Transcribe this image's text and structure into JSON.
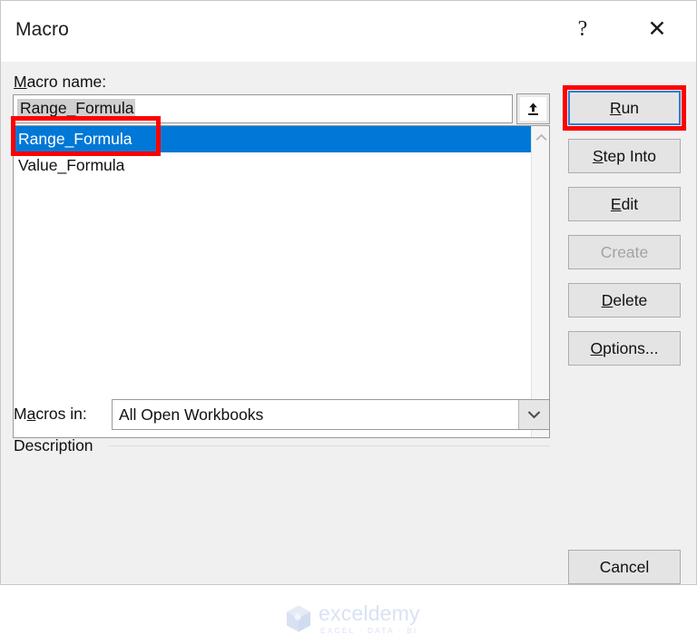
{
  "window": {
    "title": "Macro",
    "help_icon": "question-mark-icon",
    "close_icon": "close-icon"
  },
  "form": {
    "macro_name_label_pre": "M",
    "macro_name_label_post": "acro name:",
    "macro_name_value": "Range_Formula",
    "upload_icon": "arrow-up-upload-icon"
  },
  "macro_list": {
    "items": [
      {
        "name": "Range_Formula",
        "selected": true
      },
      {
        "name": "Value_Formula",
        "selected": false
      }
    ],
    "scroll_up_icon": "chevron-up-icon",
    "scroll_down_icon": "chevron-down-icon"
  },
  "macros_in": {
    "label_pre": "M",
    "label_mid": "a",
    "label_post": "cros in:",
    "selected_value": "All Open Workbooks",
    "dropdown_icon": "chevron-down-icon"
  },
  "description": {
    "label": "Description",
    "text": ""
  },
  "buttons": [
    {
      "name": "run",
      "pre": "R",
      "accel": "",
      "post": "un",
      "label": "Run",
      "disabled": false,
      "focused": true
    },
    {
      "name": "step-into",
      "pre": "",
      "accel": "S",
      "post": "tep Into",
      "label": "Step Into",
      "disabled": false,
      "focused": false
    },
    {
      "name": "edit",
      "pre": "",
      "accel": "E",
      "post": "dit",
      "label": "Edit",
      "disabled": false,
      "focused": false
    },
    {
      "name": "create",
      "pre": "",
      "accel": "",
      "post": "Create",
      "label": "Create",
      "disabled": true,
      "focused": false
    },
    {
      "name": "delete",
      "pre": "",
      "accel": "D",
      "post": "elete",
      "label": "Delete",
      "disabled": false,
      "focused": false
    },
    {
      "name": "options",
      "pre": "",
      "accel": "O",
      "post": "ptions...",
      "label": "Options...",
      "disabled": false,
      "focused": false
    },
    {
      "name": "cancel",
      "pre": "",
      "accel": "",
      "post": "Cancel",
      "label": "Cancel",
      "disabled": false,
      "focused": false
    }
  ],
  "button_labels": {
    "run_accel": "R",
    "run_rest": "un",
    "step_into_accel": "S",
    "step_into_rest": "tep Into",
    "edit_accel": "E",
    "edit_rest": "dit",
    "create": "Create",
    "delete_accel": "D",
    "delete_rest": "elete",
    "options_accel": "O",
    "options_rest": "ptions...",
    "cancel": "Cancel"
  },
  "annotations": [
    {
      "name": "run-button-highlight",
      "color": "#FE0000"
    },
    {
      "name": "selected-macro-highlight",
      "color": "#FE0000"
    }
  ],
  "watermark": {
    "name": "exceldemy",
    "tagline": "EXCEL · DATA · BI",
    "logo_icon": "hexagon-cube-logo-icon"
  },
  "colors": {
    "selection_blue": "#0078D7",
    "annotation_red": "#FE0000",
    "dialog_background": "#F0F0F0",
    "focus_border": "#2F7FD1"
  }
}
